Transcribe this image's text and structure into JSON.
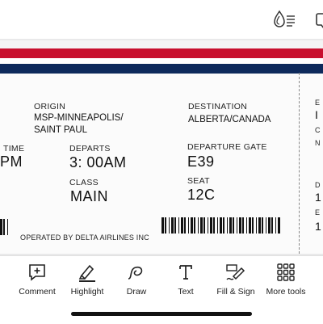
{
  "toolbar_top": {
    "buttons": [
      {
        "icon": "ink-drops-icon"
      },
      {
        "icon": "share-icon"
      }
    ]
  },
  "ticket": {
    "origin_label": "ORIGIN",
    "origin_value_line1": "MSP-MINNEAPOLIS/",
    "origin_value_line2": "SAINT PAUL",
    "destination_label": "DESTINATION",
    "destination_value": "ALBERTA/CANADA",
    "time_label": "TIME",
    "time_value": "PM",
    "departs_label": "DEPARTS",
    "departs_value": "3: 00AM",
    "gate_label": "DEPARTURE GATE",
    "gate_value": "E39",
    "class_label": "CLASS",
    "class_value": "MAIN",
    "seat_label": "SEAT",
    "seat_value": "12C",
    "operated_by": "OPERATED BY DELTA AIRLINES INC",
    "stub_chars": [
      "E",
      "I",
      "C",
      "N",
      "D",
      "1",
      "E",
      "1"
    ],
    "stripe_colors": {
      "red": "#c8102e",
      "navy": "#0e2a5c"
    }
  },
  "tools": [
    {
      "label": "Comment",
      "icon": "comment-icon"
    },
    {
      "label": "Highlight",
      "icon": "highlight-icon"
    },
    {
      "label": "Draw",
      "icon": "draw-icon"
    },
    {
      "label": "Text",
      "icon": "text-icon"
    },
    {
      "label": "Fill & Sign",
      "icon": "fill-sign-icon"
    },
    {
      "label": "More tools",
      "icon": "more-tools-icon"
    }
  ]
}
